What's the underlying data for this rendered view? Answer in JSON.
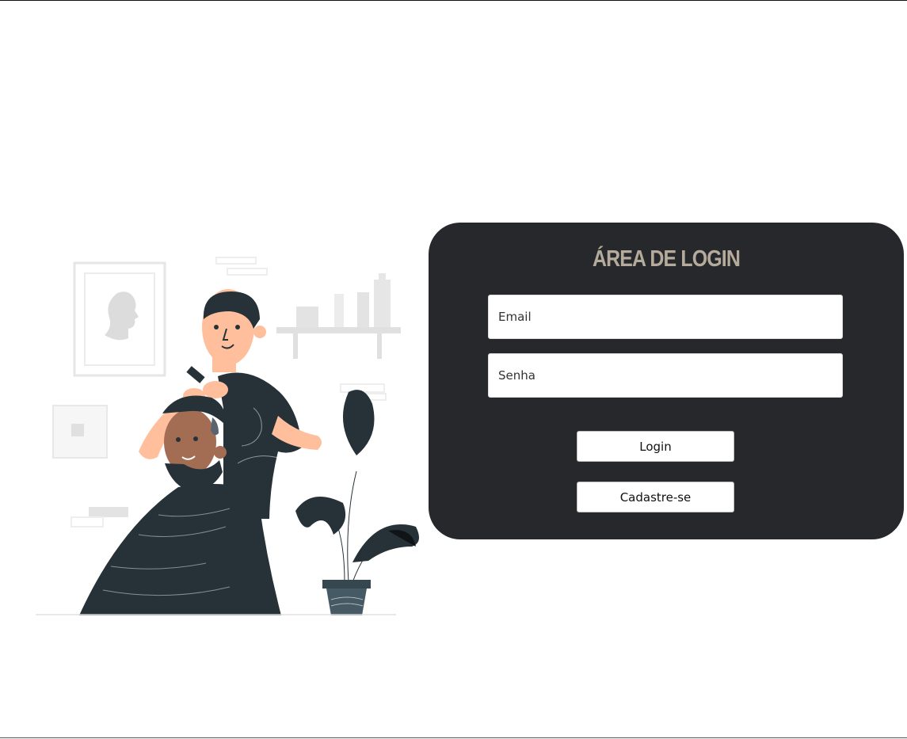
{
  "login": {
    "title": "ÁREA DE LOGIN",
    "email_placeholder": "Email",
    "password_placeholder": "Senha",
    "login_label": "Login",
    "signup_label": "Cadastre-se"
  },
  "colors": {
    "card_background": "#27282b",
    "title_color": "#b5ab9c",
    "illustration_dark": "#263238",
    "skin": "#ffbf9d"
  },
  "icons": {
    "illustration": "barber-cutting-hair-illustration"
  }
}
